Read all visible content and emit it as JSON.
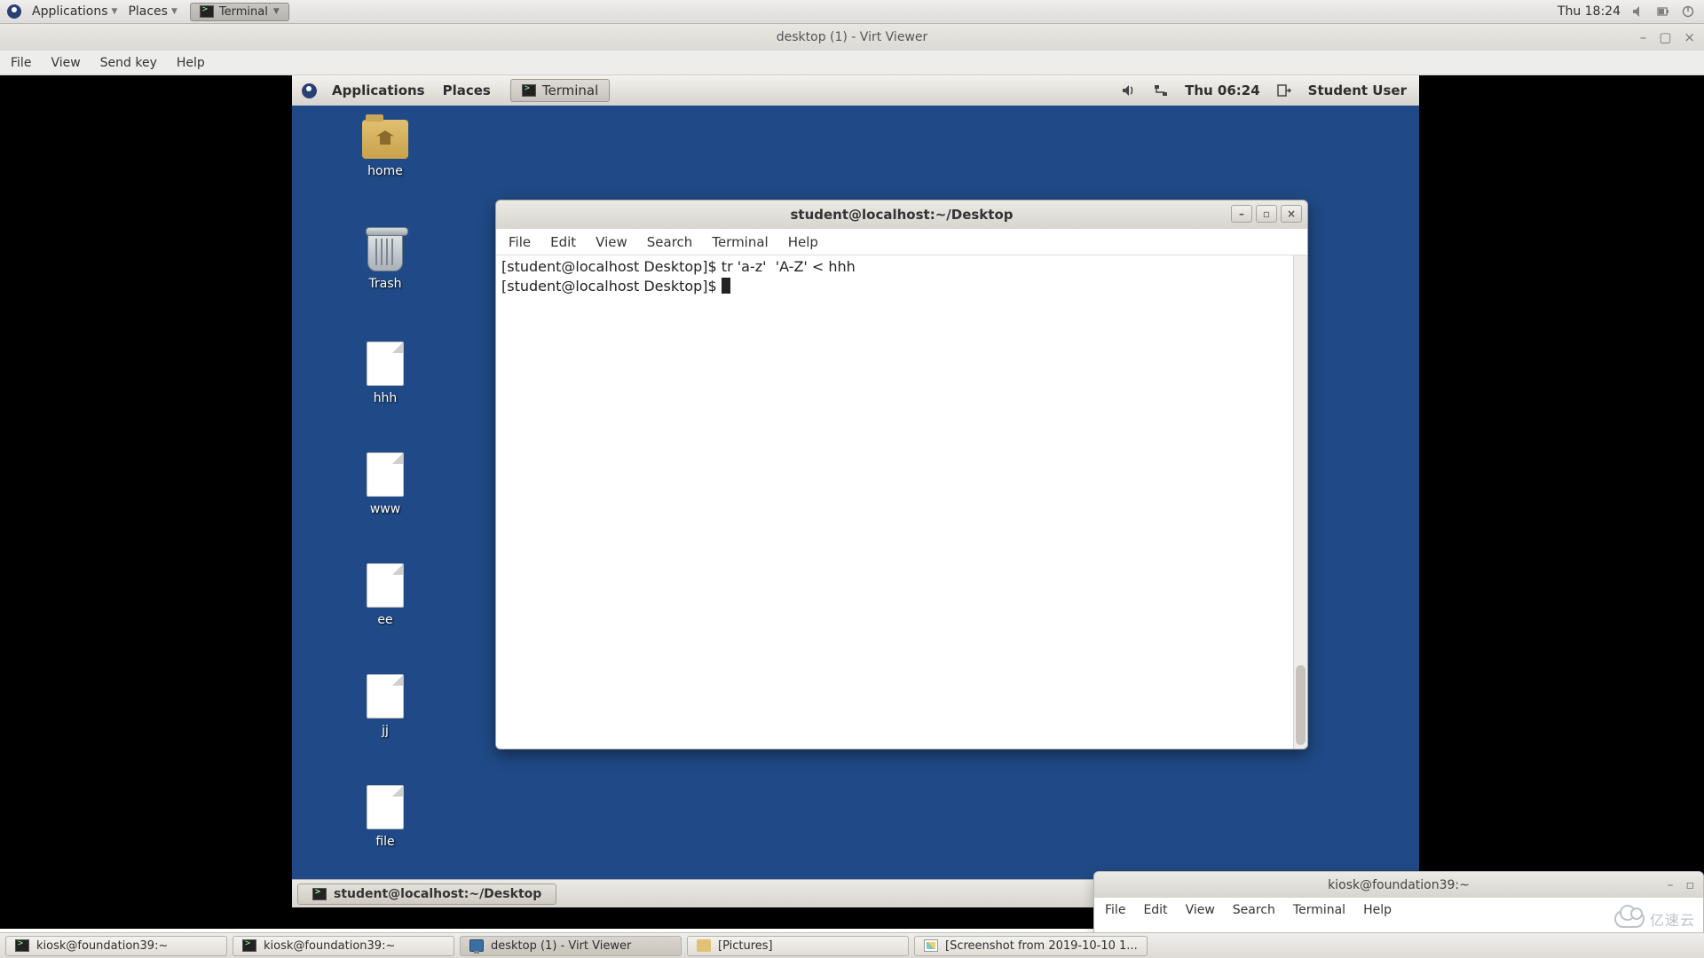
{
  "host_panel": {
    "applications": "Applications",
    "places": "Places",
    "terminal_task": "Terminal",
    "clock": "Thu 18:24"
  },
  "virt_viewer": {
    "title": "desktop (1) - Virt Viewer",
    "menu": {
      "file": "File",
      "view": "View",
      "sendkey": "Send key",
      "help": "Help"
    }
  },
  "vm_panel": {
    "applications": "Applications",
    "places": "Places",
    "terminal_task": "Terminal",
    "clock": "Thu 06:24",
    "user": "Student User"
  },
  "desktop_icons": {
    "home": "home",
    "trash": "Trash",
    "hhh": "hhh",
    "www": "www",
    "ee": "ee",
    "jj": "jj",
    "file": "file"
  },
  "g_terminal": {
    "title": "student@localhost:~/Desktop",
    "menu": {
      "file": "File",
      "edit": "Edit",
      "view": "View",
      "search": "Search",
      "terminal": "Terminal",
      "help": "Help"
    },
    "line1": "[student@localhost Desktop]$ tr 'a-z'  'A-Z' < hhh",
    "prompt2": "[student@localhost Desktop]$ "
  },
  "vm_taskbar": {
    "item": "student@localhost:~/Desktop"
  },
  "kiosk_terminal": {
    "title": "kiosk@foundation39:~",
    "menu": {
      "file": "File",
      "edit": "Edit",
      "view": "View",
      "search": "Search",
      "terminal": "Terminal",
      "help": "Help"
    }
  },
  "host_taskbar": {
    "t1": "kiosk@foundation39:~",
    "t2": "kiosk@foundation39:~",
    "t3": "desktop (1) - Virt Viewer",
    "t4": "[Pictures]",
    "t5": "[Screenshot from 2019-10-10 1..."
  },
  "watermark": "亿速云"
}
